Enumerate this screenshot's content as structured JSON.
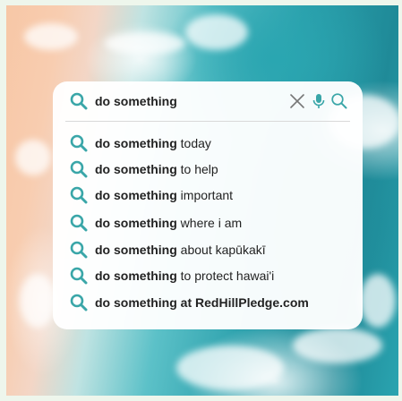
{
  "search": {
    "query": "do something"
  },
  "colors": {
    "accent": "#3aa6a8",
    "text": "#222222"
  },
  "suggestions": [
    {
      "prefix": "do something",
      "rest": " today"
    },
    {
      "prefix": "do something",
      "rest": " to help"
    },
    {
      "prefix": "do something",
      "rest": " important"
    },
    {
      "prefix": "do something",
      "rest": " where i am"
    },
    {
      "prefix": "do something",
      "rest": " about kapūkakī"
    },
    {
      "prefix": "do something",
      "rest": " to protect hawai'i"
    },
    {
      "prefix": "do something",
      "rest": " at RedHillPledge.com"
    }
  ],
  "icons": [
    "search-icon",
    "clear-icon",
    "mic-icon"
  ]
}
